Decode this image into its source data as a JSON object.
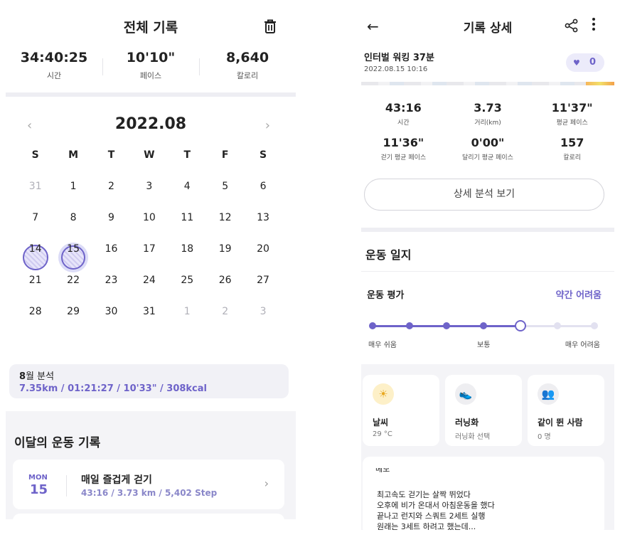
{
  "left": {
    "header": {
      "title": "전체 기록"
    },
    "stats": [
      {
        "value": "34:40:25",
        "label": "시간"
      },
      {
        "value": "10'10\"",
        "label": "페이스"
      },
      {
        "value": "8,640",
        "label": "칼로리"
      }
    ],
    "calendar": {
      "title": "2022.08",
      "prev": "‹",
      "next": "›",
      "weekdays": [
        "S",
        "M",
        "T",
        "W",
        "T",
        "F",
        "S"
      ],
      "days": [
        [
          "31",
          "1",
          "2",
          "3",
          "4",
          "5",
          "6"
        ],
        [
          "7",
          "8",
          "9",
          "10",
          "11",
          "12",
          "13"
        ],
        [
          "14",
          "15",
          "16",
          "17",
          "18",
          "19",
          "20"
        ],
        [
          "21",
          "22",
          "23",
          "24",
          "25",
          "26",
          "27"
        ],
        [
          "28",
          "29",
          "30",
          "31",
          "1",
          "2",
          "3"
        ]
      ]
    },
    "analysis": {
      "title_bold": "8",
      "title_rest": "월 분석",
      "summary": "7.35km / 01:21:27 / 10'33\" / 308kcal"
    },
    "monthly": {
      "title": "이달의 운동 기록",
      "record": {
        "dow": "MON",
        "day": "15",
        "title": "매일 즐겁게 걷기",
        "summary": "43:16 / 3.73 km / 5,402 Step"
      }
    }
  },
  "right": {
    "header": {
      "title": "기록 상세",
      "back": "←"
    },
    "workout": {
      "title": "인터벌 워킹 37분",
      "date": "2022.08.15 10:16",
      "like_count": "0"
    },
    "stats": [
      {
        "value": "43:16",
        "label": "시간"
      },
      {
        "value": "3.73",
        "label": "거리(km)"
      },
      {
        "value": "11'37\"",
        "label": "평균 페이스"
      },
      {
        "value": "11'36\"",
        "label": "걷기 평균 페이스"
      },
      {
        "value": "0'00\"",
        "label": "달리기 평균 페이스"
      },
      {
        "value": "157",
        "label": "칼로리"
      }
    ],
    "analyze_button": "상세 분석 보기",
    "log": {
      "title": "운동 일지",
      "eval_label": "운동 평가",
      "eval_value": "약간 어려움",
      "scale_low": "매우 쉬움",
      "scale_mid": "보통",
      "scale_high": "매우 어려움",
      "rating": {
        "value": 5,
        "max": 7
      }
    },
    "cards": [
      {
        "icon": "☀",
        "title": "날씨",
        "sub": "29 °C"
      },
      {
        "icon": "👟",
        "title": "러닝화",
        "sub": "러닝화 선택"
      },
      {
        "icon": "👥",
        "title": "같이 뛴 사람",
        "sub": "0 명"
      }
    ],
    "memo": {
      "heading": "메모",
      "lines": [
        "최고속도 걷기는 살짝 뛰었다",
        "오후에 비가 온대서 아침운동을 했다",
        "끝나고 런지와 스쿼트 2세트 실행",
        "원래는 3세트 하려고 했는데..."
      ]
    }
  },
  "colors": {
    "accent": "#6e63c9",
    "accent_light": "#e7e5fa",
    "band": "#eeeef3"
  }
}
